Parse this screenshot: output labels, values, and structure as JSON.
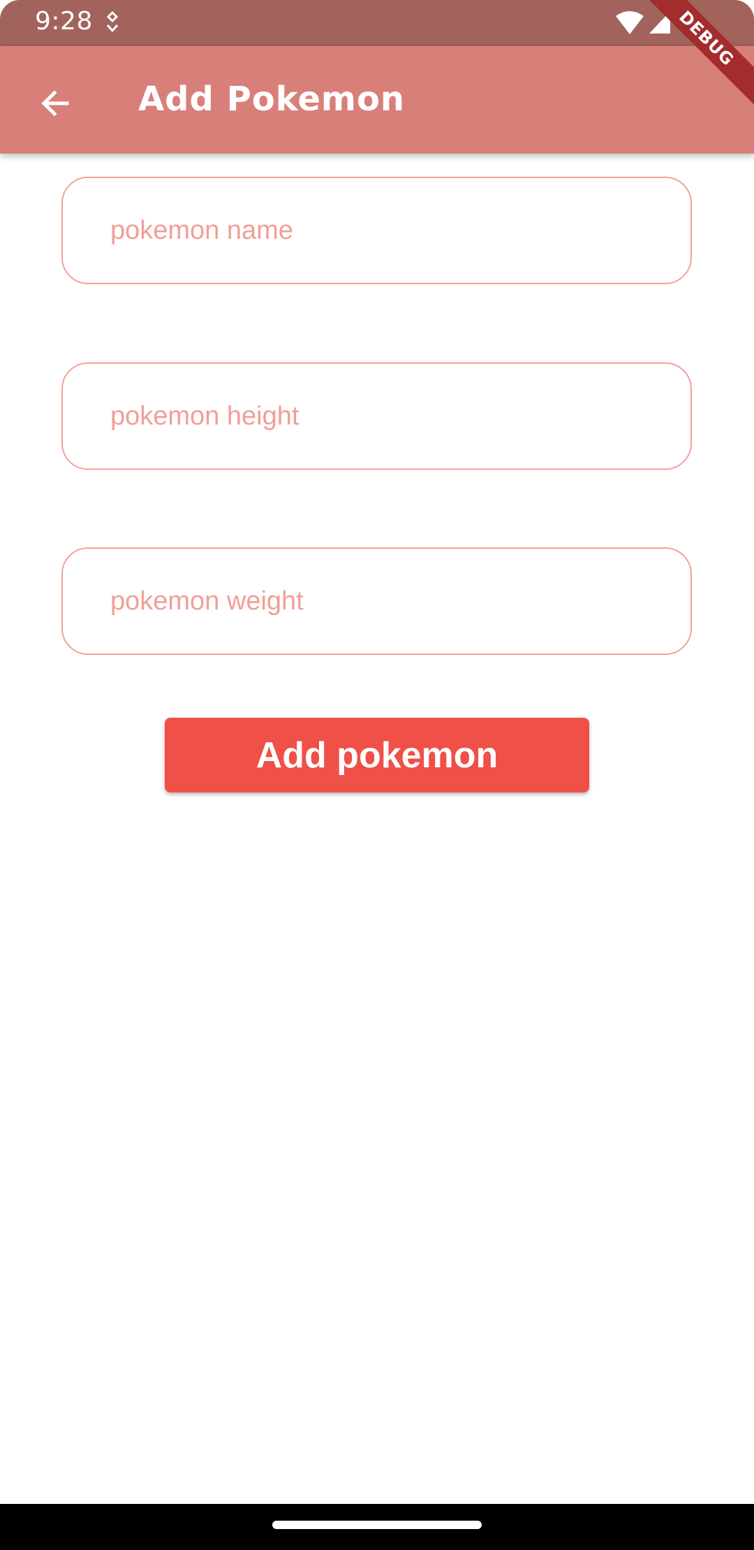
{
  "status_bar": {
    "time": "9:28",
    "icons": [
      "notification-icon",
      "wifi-icon",
      "signal-icon"
    ]
  },
  "app_bar": {
    "title": "Add Pokemon",
    "back_icon": "arrow-back-icon",
    "color": "#d97f79"
  },
  "debug_banner": {
    "label": "DEBUG"
  },
  "form": {
    "name_placeholder": "pokemon name",
    "height_placeholder": "pokemon height",
    "weight_placeholder": "pokemon weight",
    "field_border_color": "#f2a19a"
  },
  "add_button": {
    "label": "Add pokemon",
    "color": "#ef5047"
  },
  "colors": {
    "status_bar": "#a1635b",
    "accent": "#ef5047",
    "placeholder": "#f19f97"
  }
}
